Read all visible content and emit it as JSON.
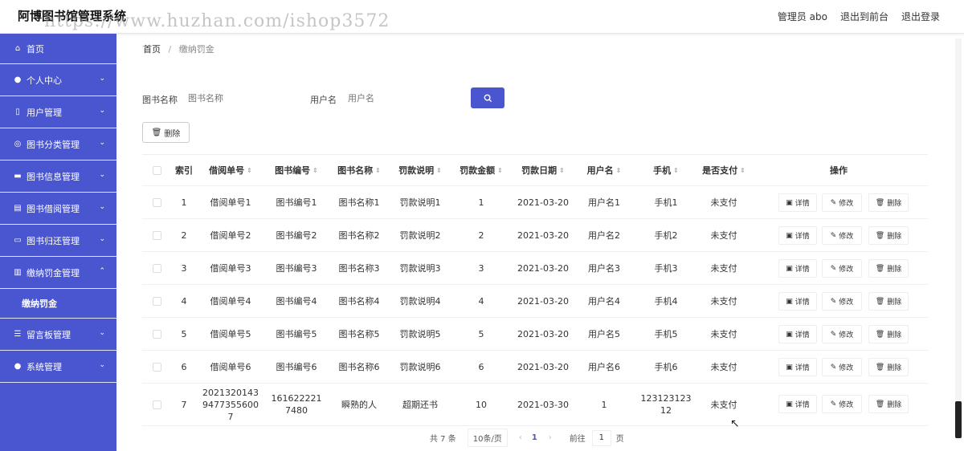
{
  "header": {
    "app_title": "阿博图书馆管理系统",
    "watermark": "https://www.huzhan.com/ishop3572",
    "user_label": "管理员 abo",
    "frontend_link": "退出到前台",
    "logout_link": "退出登录"
  },
  "sidebar": {
    "items": [
      {
        "label": "首页",
        "icon": "home-icon"
      },
      {
        "label": "个人中心",
        "icon": "user-icon"
      },
      {
        "label": "用户管理",
        "icon": "phone-icon"
      },
      {
        "label": "图书分类管理",
        "icon": "circle-icon"
      },
      {
        "label": "图书信息管理",
        "icon": "inbox-icon"
      },
      {
        "label": "图书借阅管理",
        "icon": "clipboard-icon"
      },
      {
        "label": "图书归还管理",
        "icon": "monitor-icon"
      },
      {
        "label": "缴纳罚金管理",
        "icon": "chart-icon"
      },
      {
        "label": "留言板管理",
        "icon": "list-icon"
      },
      {
        "label": "系统管理",
        "icon": "location-icon"
      }
    ],
    "submenu": {
      "label": "缴纳罚金"
    }
  },
  "breadcrumb": {
    "home": "首页",
    "separator": "/",
    "current": "缴纳罚金"
  },
  "search": {
    "book_name_label": "图书名称",
    "book_name_placeholder": "图书名称",
    "username_label": "用户名",
    "username_placeholder": "用户名",
    "search_icon": "search-icon"
  },
  "toolbar": {
    "delete_label": "删除"
  },
  "table": {
    "headers": [
      "索引",
      "借阅单号",
      "图书编号",
      "图书名称",
      "罚款说明",
      "罚款金额",
      "罚款日期",
      "用户名",
      "手机",
      "是否支付",
      "操作"
    ],
    "rows": [
      {
        "index": "1",
        "borrow_no": "借阅单号1",
        "book_no": "图书编号1",
        "book_name": "图书名称1",
        "fine_desc": "罚款说明1",
        "amount": "1",
        "date": "2021-03-20",
        "username": "用户名1",
        "phone": "手机1",
        "paid": "未支付"
      },
      {
        "index": "2",
        "borrow_no": "借阅单号2",
        "book_no": "图书编号2",
        "book_name": "图书名称2",
        "fine_desc": "罚款说明2",
        "amount": "2",
        "date": "2021-03-20",
        "username": "用户名2",
        "phone": "手机2",
        "paid": "未支付"
      },
      {
        "index": "3",
        "borrow_no": "借阅单号3",
        "book_no": "图书编号3",
        "book_name": "图书名称3",
        "fine_desc": "罚款说明3",
        "amount": "3",
        "date": "2021-03-20",
        "username": "用户名3",
        "phone": "手机3",
        "paid": "未支付"
      },
      {
        "index": "4",
        "borrow_no": "借阅单号4",
        "book_no": "图书编号4",
        "book_name": "图书名称4",
        "fine_desc": "罚款说明4",
        "amount": "4",
        "date": "2021-03-20",
        "username": "用户名4",
        "phone": "手机4",
        "paid": "未支付"
      },
      {
        "index": "5",
        "borrow_no": "借阅单号5",
        "book_no": "图书编号5",
        "book_name": "图书名称5",
        "fine_desc": "罚款说明5",
        "amount": "5",
        "date": "2021-03-20",
        "username": "用户名5",
        "phone": "手机5",
        "paid": "未支付"
      },
      {
        "index": "6",
        "borrow_no": "借阅单号6",
        "book_no": "图书编号6",
        "book_name": "图书名称6",
        "fine_desc": "罚款说明6",
        "amount": "6",
        "date": "2021-03-20",
        "username": "用户名6",
        "phone": "手机6",
        "paid": "未支付"
      },
      {
        "index": "7",
        "borrow_no": "202132014394773556007",
        "book_no": "1616222217480",
        "book_name": "瞬熟的人",
        "fine_desc": "超期还书",
        "amount": "10",
        "date": "2021-03-30",
        "username": "1",
        "phone": "12312312312",
        "paid": "未支付"
      }
    ],
    "actions": {
      "detail": "详情",
      "edit": "修改",
      "delete": "删除"
    }
  },
  "pagination": {
    "total": "共 7 条",
    "page_size": "10条/页",
    "prev": "‹",
    "current_page": "1",
    "next": "›",
    "goto_label": "前往",
    "goto_value": "1",
    "page_unit": "页"
  }
}
